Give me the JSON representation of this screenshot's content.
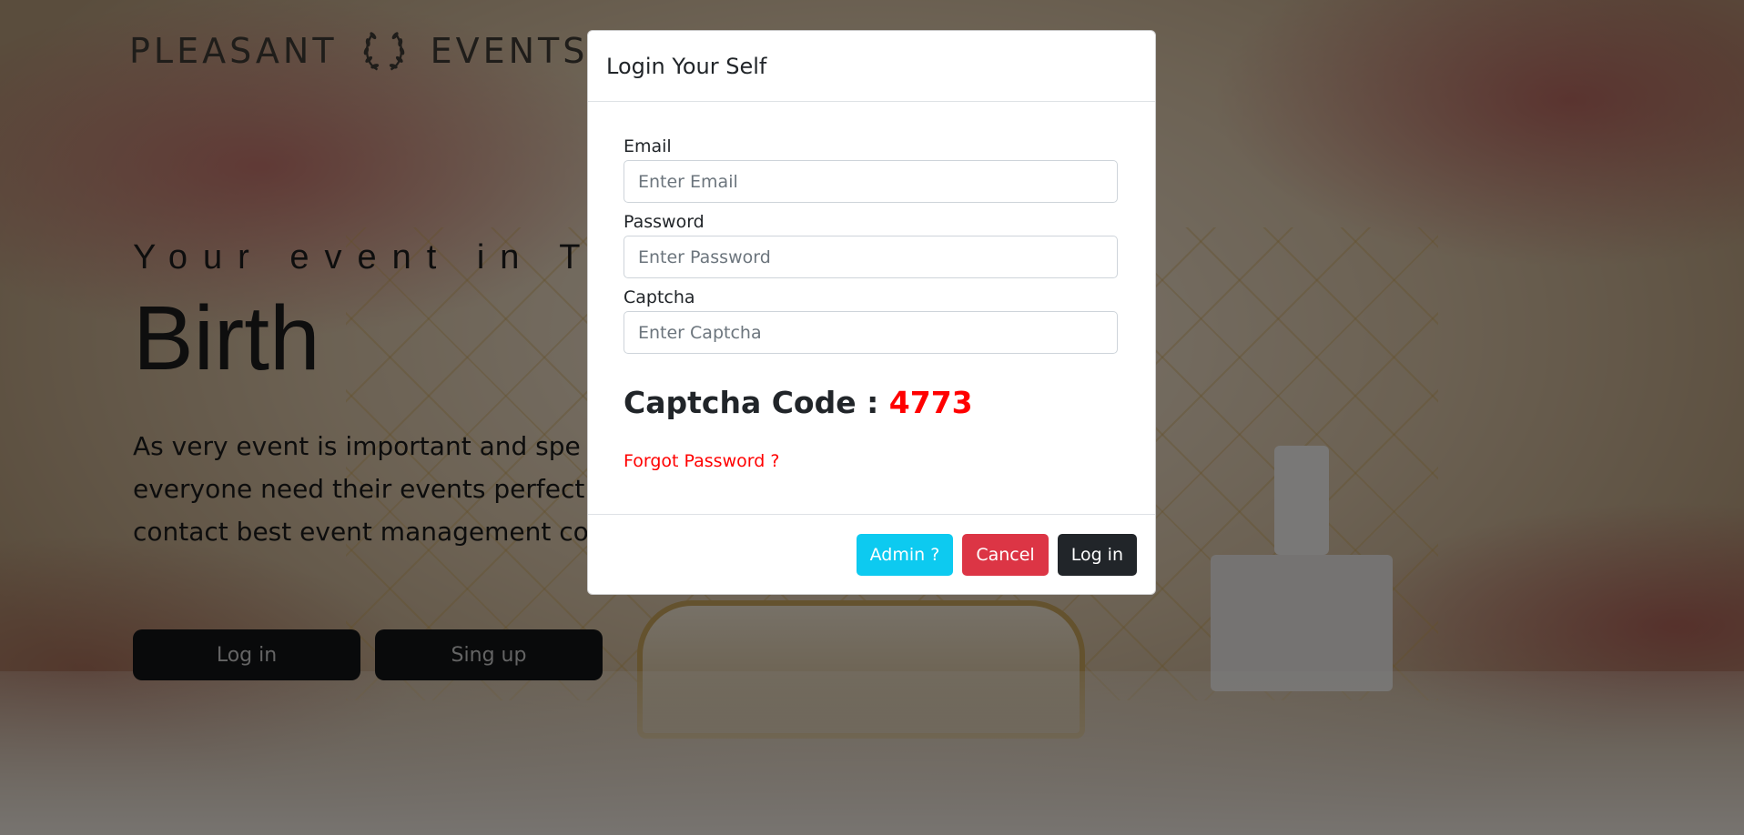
{
  "brand": {
    "left_word": "PLEASANT",
    "right_word": "EVENTS",
    "logo_icon": "laurel-wreath-icon"
  },
  "hero": {
    "tagline": "Your event in Trus",
    "headline": "Birth",
    "description_lines": [
      "As very event is important and spe",
      "everyone need their events perfect",
      "contact best event management co"
    ],
    "buttons": {
      "login_label": "Log in",
      "signup_label": "Sing up"
    }
  },
  "modal": {
    "title": "Login Your Self",
    "email": {
      "label": "Email",
      "placeholder": "Enter Email",
      "value": ""
    },
    "password": {
      "label": "Password",
      "placeholder": "Enter Password",
      "value": ""
    },
    "captcha": {
      "label": "Captcha",
      "placeholder": "Enter Captcha",
      "value": ""
    },
    "captcha_code_label": "Captcha Code : ",
    "captcha_code": "4773",
    "forgot_password": "Forgot Password ?",
    "footer": {
      "admin_label": "Admin ?",
      "cancel_label": "Cancel",
      "login_label": "Log in"
    }
  },
  "colors": {
    "admin_button": "#0dcaf0",
    "cancel_button": "#dc3545",
    "login_button": "#212529",
    "captcha_code": "#ff0000",
    "forgot_link": "#ff0000",
    "hero_button": "#121416"
  }
}
